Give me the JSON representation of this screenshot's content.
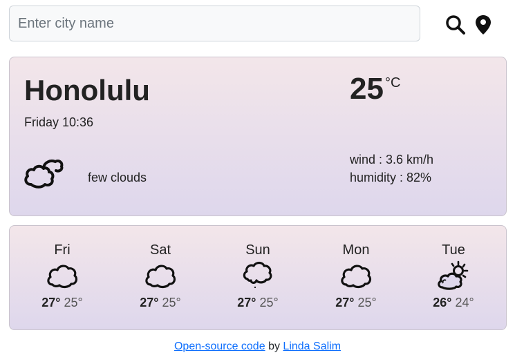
{
  "search": {
    "placeholder": "Enter city name",
    "value": ""
  },
  "icons": {
    "search": "search-icon",
    "location": "map-marker-icon"
  },
  "current": {
    "city": "Honolulu",
    "datetime": "Friday 10:36",
    "temperature": "25",
    "unit": "°C",
    "description": "few clouds",
    "wind": "wind : 3.6 km/h",
    "humidity": "humidity : 82%",
    "icon": "few-clouds-icon"
  },
  "forecast": [
    {
      "day": "Fri",
      "max": "27°",
      "min": "25°",
      "icon": "cloud-icon"
    },
    {
      "day": "Sat",
      "max": "27°",
      "min": "25°",
      "icon": "cloud-icon"
    },
    {
      "day": "Sun",
      "max": "27°",
      "min": "25°",
      "icon": "rain-cloud-icon"
    },
    {
      "day": "Mon",
      "max": "27°",
      "min": "25°",
      "icon": "cloud-icon"
    },
    {
      "day": "Tue",
      "max": "26°",
      "min": "24°",
      "icon": "partly-sunny-icon"
    }
  ],
  "footer": {
    "code_link": "Open-source code",
    "by": "by",
    "author_link": "Linda Salim"
  },
  "colors": {
    "link": "#0d6efd",
    "card_top": "#f3e6ea",
    "card_bottom": "#ded7ec"
  }
}
